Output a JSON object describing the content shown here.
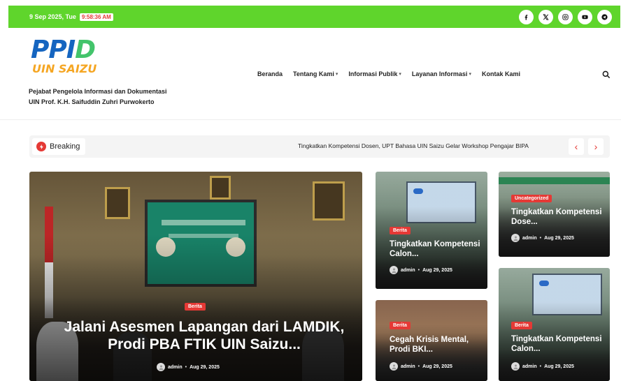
{
  "topbar": {
    "date": "9 Sep 2025, Tue",
    "time": "9:58:36 AM",
    "socials": [
      "facebook-icon",
      "x-icon",
      "instagram-icon",
      "youtube-icon",
      "telegram-icon"
    ]
  },
  "header": {
    "logo_main": "PPID",
    "logo_sub": "UIN SAIZU",
    "tagline_line1": "Pejabat Pengelola Informasi dan Dokumentasi",
    "tagline_line2": "UIN Prof. K.H. Saifuddin Zuhri Purwokerto"
  },
  "nav": {
    "items": [
      {
        "label": "Beranda",
        "dropdown": false
      },
      {
        "label": "Tentang Kami",
        "dropdown": true
      },
      {
        "label": "Informasi Publik",
        "dropdown": true
      },
      {
        "label": "Layanan Informasi",
        "dropdown": true
      },
      {
        "label": "Kontak Kami",
        "dropdown": false
      }
    ],
    "caret": "▾"
  },
  "breaking": {
    "label": "Breaking",
    "headline": "Tingkatkan Kompetensi Dosen, UPT Bahasa UIN Saizu Gelar Workshop Pengajar BIPA",
    "prev": "‹",
    "next": "›"
  },
  "posts": {
    "featured": {
      "category": "Berita",
      "title": "Jalani Asesmen Lapangan dari LAMDIK, Prodi PBA FTIK UIN Saizu...",
      "author": "admin",
      "date": "Aug 29, 2025"
    },
    "card1": {
      "category": "Berita",
      "title": "Tingkatkan Kompetensi Calon...",
      "author": "admin",
      "date": "Aug 29, 2025"
    },
    "card2": {
      "category": "Uncategorized",
      "title": "Tingkatkan Kompetensi Dose...",
      "author": "admin",
      "date": "Aug 29, 2025"
    },
    "card3": {
      "category": "Berita",
      "title": "Cegah Krisis Mental, Prodi BKI...",
      "author": "admin",
      "date": "Aug 29, 2025"
    },
    "card4": {
      "category": "Berita",
      "title": "Tingkatkan Kompetensi Calon...",
      "author": "admin",
      "date": "Aug 29, 2025"
    }
  },
  "meta_separator": "•",
  "colors": {
    "accent_green": "#5fd52c",
    "badge_red": "#e53935",
    "logo_blue": "#1565c0",
    "logo_orange": "#f5a623"
  }
}
